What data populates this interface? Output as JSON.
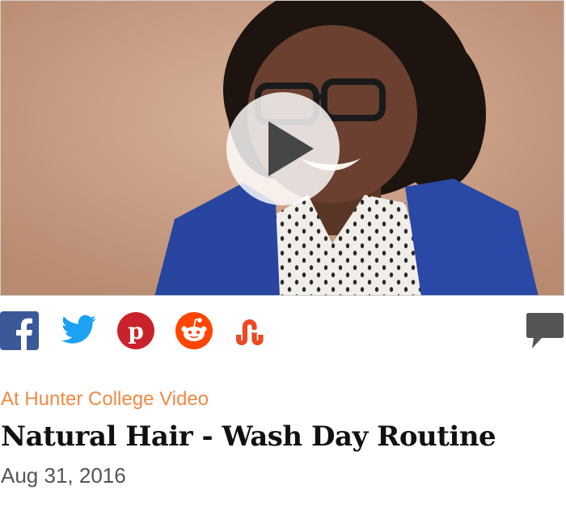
{
  "video": {
    "play_icon": "play-icon",
    "thumbnail_subject": "person-portrait"
  },
  "share": {
    "items": [
      {
        "name": "facebook",
        "icon": "facebook-icon",
        "color": "#3b5998"
      },
      {
        "name": "twitter",
        "icon": "twitter-icon",
        "color": "#1da1f2"
      },
      {
        "name": "pinterest",
        "icon": "pinterest-icon",
        "color": "#c8232c"
      },
      {
        "name": "reddit",
        "icon": "reddit-icon",
        "color": "#ff4500"
      },
      {
        "name": "stumbleupon",
        "icon": "stumbleupon-icon",
        "color": "#eb4924"
      }
    ],
    "comment_icon": "comment-icon",
    "comment_color": "#555555"
  },
  "article": {
    "category": "At Hunter College Video",
    "title": "Natural Hair - Wash Day Routine",
    "date": "Aug 31, 2016"
  },
  "colors": {
    "category": "#ee8a44",
    "title": "#111111",
    "date": "#555555"
  }
}
